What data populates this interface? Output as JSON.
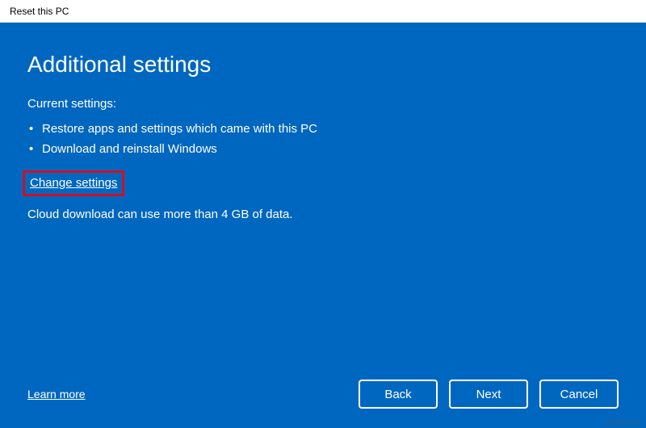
{
  "titlebar": {
    "title": "Reset this PC"
  },
  "main": {
    "heading": "Additional settings",
    "current_settings_label": "Current settings:",
    "bullets": [
      "Restore apps and settings which came with this PC",
      "Download and reinstall Windows"
    ],
    "change_settings_link": "Change settings",
    "info_text": "Cloud download can use more than 4 GB of data."
  },
  "footer": {
    "learn_more": "Learn more",
    "buttons": {
      "back": "Back",
      "next": "Next",
      "cancel": "Cancel"
    }
  },
  "watermark": "wsxdn.com"
}
